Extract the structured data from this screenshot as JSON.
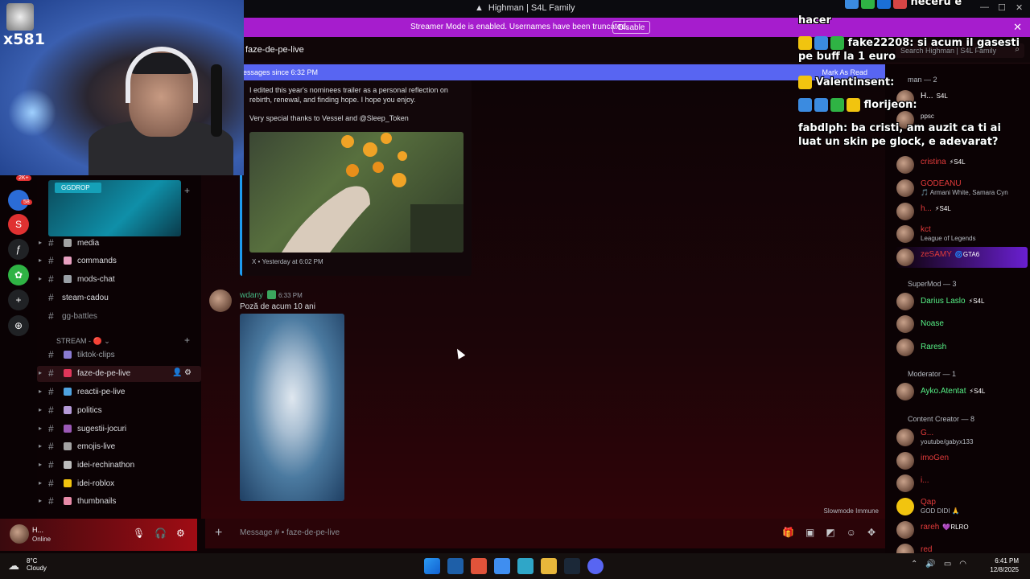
{
  "window": {
    "title": "Highman | S4L Family",
    "controls": [
      "—",
      "☐",
      "✕"
    ]
  },
  "banner": {
    "text": "Streamer Mode is enabled. Usernames have been truncated.",
    "button": "Disable",
    "close": "✕"
  },
  "channel_header": {
    "name": "faze-de-pe-live",
    "search_placeholder": "Search Highman | S4L Family"
  },
  "new_messages": {
    "label": "essages since 6:32 PM",
    "action": "Mark As Read"
  },
  "embed": {
    "description": "I edited this year's nominees trailer as a personal reflection on rebirth, renewal, and finding hope. I hope you enjoy.",
    "thanks": "Very special thanks to Vessel and @Sleep_Token",
    "footer": "X  •  Yesterday at 6:02 PM"
  },
  "message": {
    "author": "wdany",
    "time": "6:33 PM",
    "text": "Poză de acum 10 ani"
  },
  "slowmode": "Slowmode Immune",
  "composer": {
    "placeholder": "Message #      • faze-de-pe-live",
    "plus": "+"
  },
  "servers": [
    {
      "glyph": "◉",
      "color": "#2b6cd6"
    },
    {
      "glyph": "S",
      "color": "#e03131"
    },
    {
      "glyph": "ƒ",
      "color": "#202225"
    },
    {
      "glyph": "✿",
      "color": "#2fb344"
    },
    {
      "glyph": "+",
      "color": "#202225"
    },
    {
      "glyph": "⊕",
      "color": "#202225"
    }
  ],
  "server_badges": {
    "top": "2K+",
    "second": "58"
  },
  "ggdrop_label": "GGDROP",
  "channels_top": [
    {
      "name": "media",
      "dot": "#a3a3a3"
    },
    {
      "name": "commands",
      "dot": "#e8a0c0"
    },
    {
      "name": "mods-chat",
      "dot": "#9aa0a6"
    },
    {
      "name": "steam-cadou",
      "dot": ""
    },
    {
      "name": "gg-battles",
      "dot": ""
    }
  ],
  "category_stream": "STREAM - 🔴 ⌄",
  "channels_stream": [
    {
      "name": "tiktok-clips",
      "dot": "#8a7bd1"
    },
    {
      "name": "faze-de-pe-live",
      "dot": "#e0365a"
    },
    {
      "name": "reactii-pe-live",
      "dot": "#4fa3e0"
    },
    {
      "name": "politics",
      "dot": "#b59ad8"
    },
    {
      "name": "sugestii-jocuri",
      "dot": "#9b59b6"
    },
    {
      "name": "emojis-live",
      "dot": "#a3a3a3"
    },
    {
      "name": "idei-rechinathon",
      "dot": "#bdbdbd"
    },
    {
      "name": "idei-roblox",
      "dot": "#f1c40f"
    },
    {
      "name": "thumbnails",
      "dot": "#e88ba8"
    }
  ],
  "user": {
    "name": "H...",
    "status": "Online"
  },
  "members": {
    "group_top": "man — 2",
    "top_members": [
      {
        "name": "H...",
        "tag": "S4L",
        "color": "#fff",
        "sub": ""
      },
      {
        "name": "ppsc",
        "tag": "",
        "color": "#dcdde1",
        "sub": ""
      },
      {
        "name": "cristina",
        "tag": "⚡S4L",
        "color": "#e23b3b",
        "sub": ""
      },
      {
        "name": "GODEANU",
        "tag": "",
        "color": "#e23b3b",
        "sub": "🎵 Armani White, Samara Cyn"
      },
      {
        "name": "h...",
        "tag": "⚡S4L",
        "color": "#e23b3b",
        "sub": ""
      },
      {
        "name": "kct",
        "tag": "",
        "color": "#e23b3b",
        "sub": "League of Legends"
      },
      {
        "name": "zeSAMY",
        "tag": "🌀GTA6",
        "color": "#e23b3b",
        "sub": ""
      }
    ],
    "supermod_group": "SuperMod — 3",
    "supermods": [
      {
        "name": "Darius Laslo",
        "tag": "⚡S4L",
        "color": "#57f287"
      },
      {
        "name": "Noase",
        "tag": "",
        "color": "#57f287"
      },
      {
        "name": "Raresh",
        "tag": "",
        "color": "#57f287"
      }
    ],
    "moderator_group": "Moderator — 1",
    "moderators": [
      {
        "name": "Ayko.Atentat",
        "tag": "⚡S4L",
        "color": "#57f287"
      }
    ],
    "creator_group": "Content Creator — 8",
    "creators": [
      {
        "name": "G...",
        "sub": "youtube/gabyx133",
        "tag": "",
        "color": "#e23b3b"
      },
      {
        "name": "imoGen",
        "sub": "",
        "tag": "",
        "color": "#e23b3b"
      },
      {
        "name": "i...",
        "sub": "",
        "tag": "",
        "color": "#e23b3b"
      },
      {
        "name": "Qap",
        "sub": "GOD DIDI 🙏",
        "tag": "",
        "color": "#e23b3b"
      },
      {
        "name": "rareh",
        "sub": "",
        "tag": "💜RLRO",
        "color": "#e23b3b"
      },
      {
        "name": "red",
        "sub": "",
        "tag": "",
        "color": "#e23b3b"
      }
    ]
  },
  "overlay": {
    "lines": [
      {
        "user": "",
        "text": "neceru e"
      },
      {
        "user": "",
        "text": "hacer"
      },
      {
        "user": "fake22208:",
        "text": " si acum il gasesti pe buff la 1 euro"
      },
      {
        "user": "Valentinsent:",
        "text": ""
      },
      {
        "user": "florijeon:",
        "text": ""
      },
      {
        "user": "fabdlph:",
        "text": " ba cristi, am auzit ca ti ai luat un skin pe glock, e adevarat?"
      }
    ]
  },
  "webcam": {
    "label": "x581"
  },
  "taskbar": {
    "temp": "8°C",
    "weather": "Cloudy",
    "time": "6:41 PM",
    "date": "12/8/2025"
  }
}
